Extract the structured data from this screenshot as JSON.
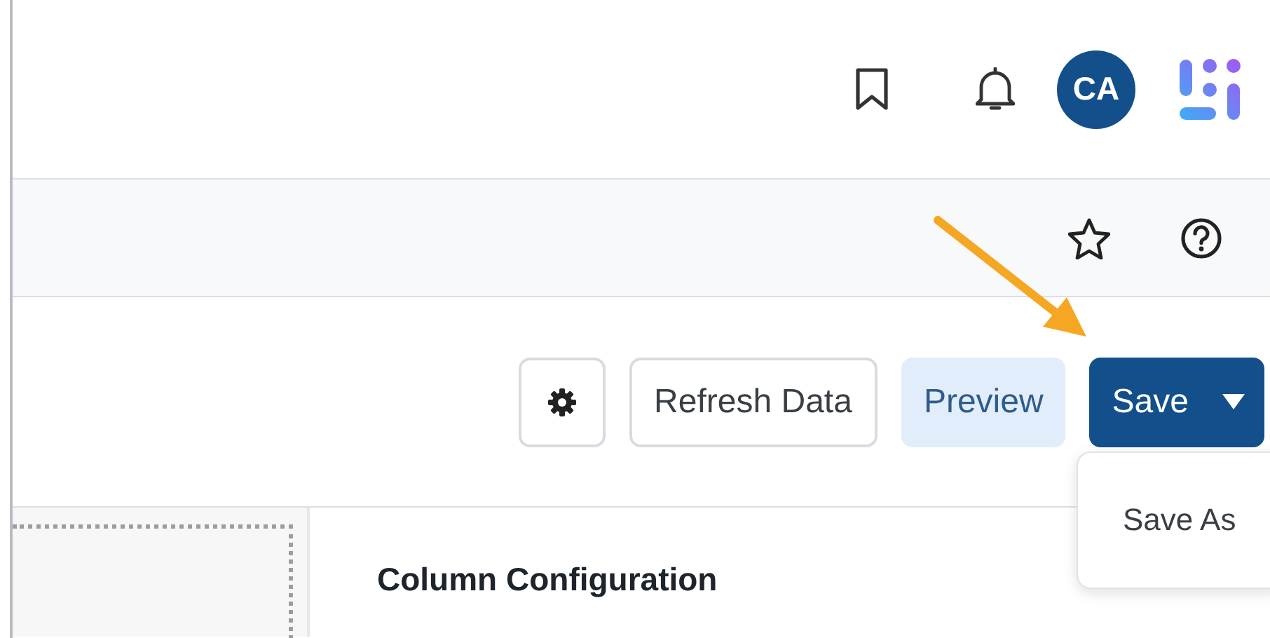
{
  "header": {
    "avatar_initials": "CA"
  },
  "toolbar": {
    "buttons": [
      {
        "kind": "settings"
      },
      {
        "kind": "outline",
        "label": "Refresh Data"
      },
      {
        "kind": "soft",
        "label": "Preview"
      },
      {
        "kind": "split",
        "label": "Save",
        "menu_open": true,
        "menu_items": [
          "Save As"
        ]
      }
    ]
  },
  "panel": {
    "title": "Column Configuration"
  }
}
